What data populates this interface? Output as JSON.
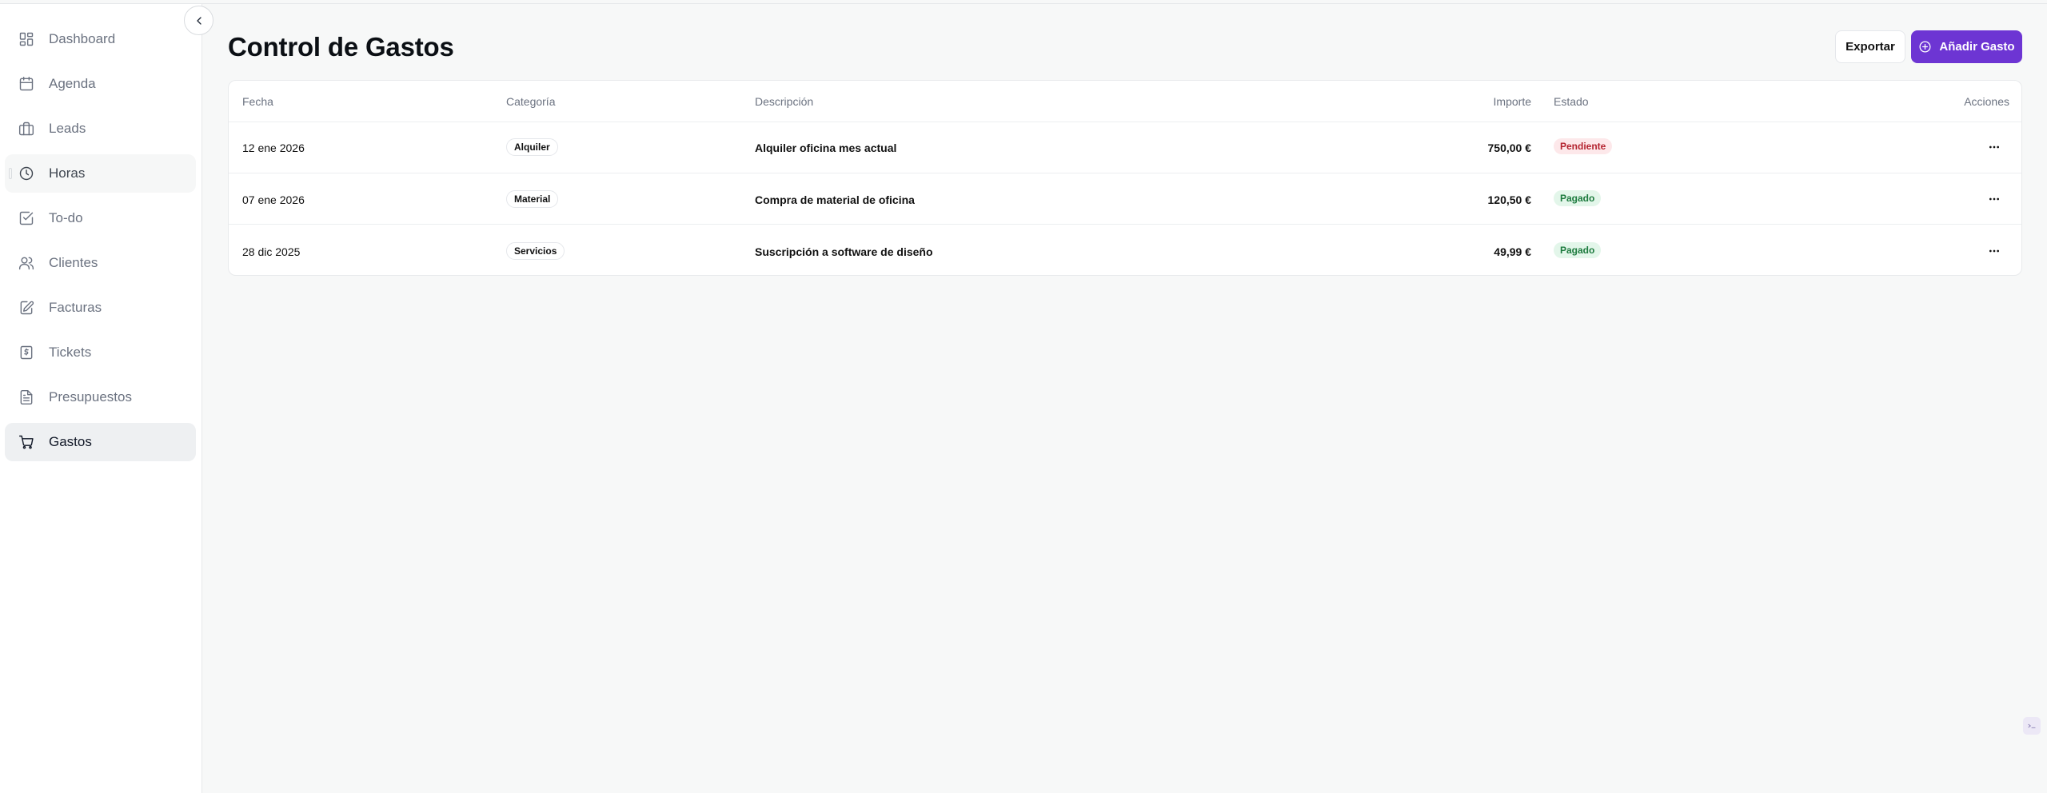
{
  "sidebar": {
    "items": [
      {
        "label": "Dashboard",
        "icon": "dashboard-grid-icon"
      },
      {
        "label": "Agenda",
        "icon": "calendar-icon"
      },
      {
        "label": "Leads",
        "icon": "briefcase-icon"
      },
      {
        "label": "Horas",
        "icon": "clock-icon"
      },
      {
        "label": "To-do",
        "icon": "checkbox-icon"
      },
      {
        "label": "Clientes",
        "icon": "users-icon"
      },
      {
        "label": "Facturas",
        "icon": "edit-document-icon"
      },
      {
        "label": "Tickets",
        "icon": "receipt-icon"
      },
      {
        "label": "Presupuestos",
        "icon": "file-text-icon"
      },
      {
        "label": "Gastos",
        "icon": "shopping-cart-icon"
      }
    ],
    "active": "Gastos",
    "hovered": "Horas"
  },
  "header": {
    "title": "Control de Gastos",
    "export_label": "Exportar",
    "add_label": "Añadir Gasto"
  },
  "table": {
    "columns": {
      "fecha": "Fecha",
      "categoria": "Categoría",
      "descripcion": "Descripción",
      "importe": "Importe",
      "estado": "Estado",
      "acciones": "Acciones"
    },
    "rows": [
      {
        "fecha": "12 ene 2026",
        "categoria": "Alquiler",
        "descripcion": "Alquiler oficina mes actual",
        "importe": "750,00 €",
        "estado": "Pendiente"
      },
      {
        "fecha": "07 ene 2026",
        "categoria": "Material",
        "descripcion": "Compra de material de oficina",
        "importe": "120,50 €",
        "estado": "Pagado"
      },
      {
        "fecha": "28 dic 2025",
        "categoria": "Servicios",
        "descripcion": "Suscripción a software de diseño",
        "importe": "49,99 €",
        "estado": "Pagado"
      }
    ]
  },
  "colors": {
    "accent": "#6d35d3",
    "pending_bg": "#fde8ea",
    "pending_text": "#b4232f",
    "paid_bg": "#e3f6ea",
    "paid_text": "#1c7a3d"
  }
}
